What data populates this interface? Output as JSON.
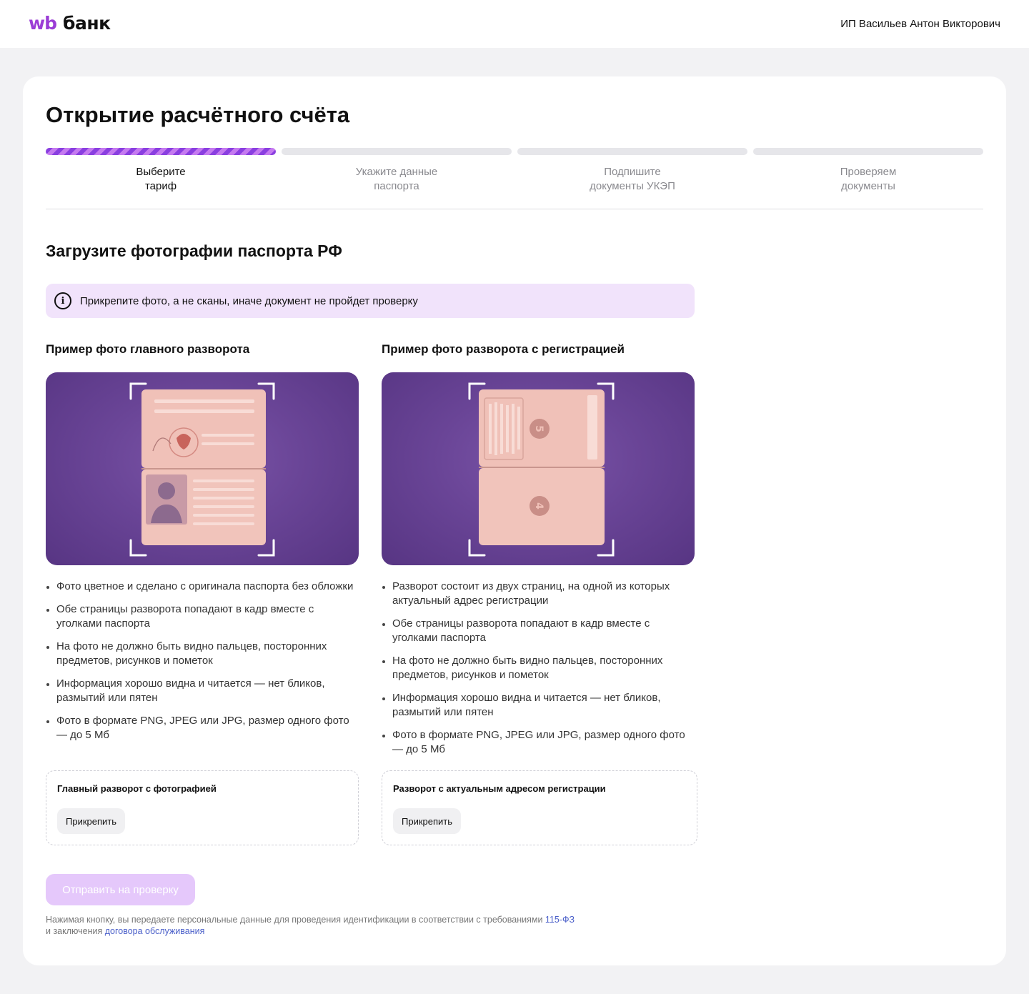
{
  "header": {
    "logo_wb": "wb",
    "logo_bank": "банк",
    "user_name": "ИП Васильев Антон Викторович"
  },
  "page": {
    "title": "Открытие расчётного счёта"
  },
  "progress": {
    "current_step": 1,
    "steps": [
      {
        "label": "Выберите\nтариф"
      },
      {
        "label": "Укажите данные\nпаспорта"
      },
      {
        "label": "Подпишите\nдокументы УКЭП"
      },
      {
        "label": "Проверяем\nдокументы"
      }
    ]
  },
  "upload_section": {
    "title": "Загрузите фотографии паспорта РФ",
    "info_icon": "info-icon",
    "info_text": "Прикрепите фото, а не сканы, иначе документ не пройдет проверку",
    "columns": [
      {
        "title": "Пример фото главного разворота",
        "rules": [
          "Фото цветное и сделано с оригинала паспорта без обложки",
          "Обе страницы разворота попадают в кадр вместе с уголками паспорта",
          "На фото не должно быть видно пальцев, посторонних предметов, рисунков и пометок",
          "Информация хорошо видна и читается — нет бликов, размытий или пятен",
          "Фото в формате PNG, JPEG или JPG, размер одного фото — до 5 Мб"
        ],
        "upload_label": "Главный разворот с фотографией",
        "attach_label": "Прикрепить"
      },
      {
        "title": "Пример фото разворота с регистрацией",
        "page_numbers": [
          "5",
          "4"
        ],
        "rules": [
          "Разворот состоит из двух страниц, на одной из которых актуальный адрес регистрации",
          "Обе страницы разворота попадают в кадр вместе с уголками паспорта",
          "На фото не должно быть видно пальцев, посторонних предметов, рисунков и пометок",
          "Информация хорошо видна и читается — нет бликов, размытий или пятен",
          "Фото в формате PNG, JPEG или JPG, размер одного фото — до 5 Мб"
        ],
        "upload_label": "Разворот с актуальным адресом регистрации",
        "attach_label": "Прикрепить"
      }
    ]
  },
  "submit": {
    "label": "Отправить на проверку",
    "disabled": true
  },
  "legal": {
    "text_1": "Нажимая кнопку, вы передаете персональные данные для проведения идентификации в соответствии с требованиями ",
    "link_1": "115-ФЗ",
    "text_2": "и заключения ",
    "link_2": "договора обслуживания"
  },
  "colors": {
    "brand": "#9b3dd6",
    "info_bg": "#f1e3fb",
    "submit_disabled": "#e5c8fb",
    "link": "#4a5fc9"
  }
}
